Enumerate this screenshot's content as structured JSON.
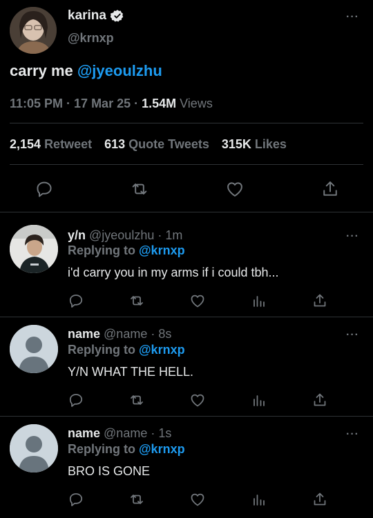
{
  "main": {
    "name": "karina",
    "handle": "@krnxp",
    "text_prefix": "carry me ",
    "text_mention": "@jyeoulzhu",
    "time": "11:05 PM · 17 Mar 25 · ",
    "views_count": "1.54M",
    "views_label": " Views",
    "retweets": "2,154",
    "retweets_label": "Retweet",
    "quotes": "613",
    "quotes_label": "Quote Tweets",
    "likes": "315K",
    "likes_label": "Likes",
    "more": "···"
  },
  "replies": [
    {
      "name": "y/n",
      "meta": " @jyeoulzhu · 1m",
      "replying_label": "Replying to ",
      "replying_to": "@krnxp",
      "text": "i'd carry you in my arms if i could tbh...",
      "more": "···"
    },
    {
      "name": "name",
      "meta": " @name · 8s",
      "replying_label": "Replying to ",
      "replying_to": "@krnxp",
      "text": "Y/N WHAT THE HELL.",
      "more": "···"
    },
    {
      "name": "name",
      "meta": " @name · 1s",
      "replying_label": "Replying to ",
      "replying_to": "@krnxp",
      "text": "BRO IS GONE",
      "more": "···"
    }
  ],
  "colors": {
    "background": "#000000",
    "text": "#e7e9ea",
    "secondary": "#71767b",
    "accent": "#1d9bf0"
  }
}
